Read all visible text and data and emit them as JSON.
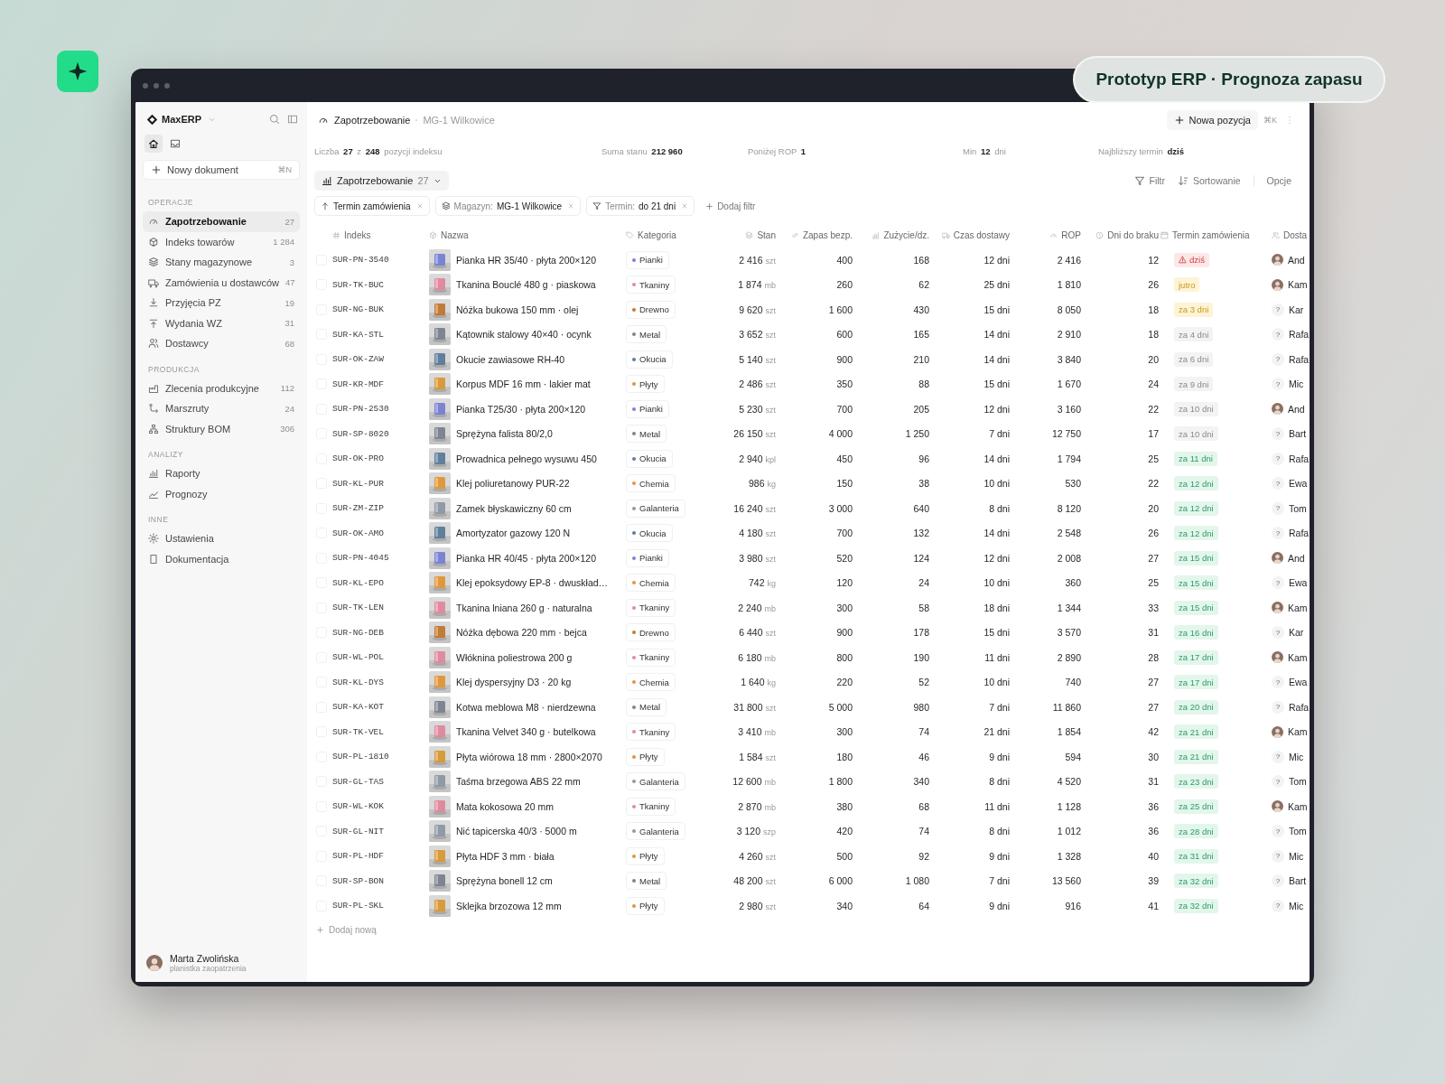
{
  "overlay_label": "Prototyp ERP · Prognoza zapasu",
  "sidebar": {
    "brand": "MaxERP",
    "top_icons": [
      {
        "kind": "home",
        "selected": true
      },
      {
        "kind": "inbox",
        "selected": false
      }
    ],
    "new_document": {
      "label": "Nowy dokument",
      "shortcut": "⌘N"
    },
    "sections": [
      {
        "title": "OPERACJE",
        "items": [
          {
            "label": "Zapotrzebowanie",
            "count": "27",
            "kind": "gauge",
            "selected": true
          },
          {
            "label": "Indeks towarów",
            "count": "1 284",
            "kind": "cube",
            "selected": false
          },
          {
            "label": "Stany magazynowe",
            "count": "3",
            "kind": "layers",
            "selected": false
          },
          {
            "label": "Zamówienia u dostawców",
            "count": "47",
            "kind": "truck",
            "selected": false
          },
          {
            "label": "Przyjęcia PZ",
            "count": "19",
            "kind": "download",
            "selected": false
          },
          {
            "label": "Wydania WZ",
            "count": "31",
            "kind": "upload",
            "selected": false
          },
          {
            "label": "Dostawcy",
            "count": "68",
            "kind": "people",
            "selected": false
          }
        ]
      },
      {
        "title": "PRODUKCJA",
        "items": [
          {
            "label": "Zlecenia produkcyjne",
            "count": "112",
            "kind": "factory",
            "selected": false
          },
          {
            "label": "Marszruty",
            "count": "24",
            "kind": "route",
            "selected": false
          },
          {
            "label": "Struktury BOM",
            "count": "306",
            "kind": "hierarchy",
            "selected": false
          }
        ]
      },
      {
        "title": "ANALIZY",
        "items": [
          {
            "label": "Raporty",
            "kind": "chart",
            "selected": false
          },
          {
            "label": "Prognozy",
            "kind": "trend",
            "selected": false
          }
        ]
      },
      {
        "title": "INNE",
        "items": [
          {
            "label": "Ustawienia",
            "kind": "settings",
            "selected": false
          },
          {
            "label": "Dokumentacja",
            "kind": "document",
            "selected": false
          }
        ]
      }
    ],
    "user": {
      "name": "Marta Zwolińska",
      "role": "planistka zaopatrzenia"
    }
  },
  "header": {
    "breadcrumb": [
      "Zapotrzebowanie",
      "MG-1 Wilkowice"
    ],
    "new_button": "Nowa pozycja",
    "shortcut": "⌘K"
  },
  "stats": [
    "Liczba **27** z **248** pozycji indeksu",
    "Suma stanu **212 960**",
    "Poniżej ROP **1**",
    "Min **12** dni",
    "Najbliższy termin **dziś**"
  ],
  "view": {
    "label": "Zapotrzebowanie",
    "count": "27"
  },
  "toolbar": [
    {
      "label": "Filtr",
      "kind": "filter"
    },
    {
      "label": "Sortowanie",
      "kind": "sort"
    },
    {
      "label": "Opcje",
      "kind": "plain"
    }
  ],
  "filters": [
    {
      "kind": "sort",
      "label": "Termin zamówienia"
    },
    {
      "kind": "warehouse",
      "label": "Magazyn:",
      "value": "MG-1 Wilkowice"
    },
    {
      "kind": "filter",
      "label": "Termin:",
      "value": "do 21 dni"
    }
  ],
  "add_filter": "Dodaj filtr",
  "table": {
    "columns": [
      {
        "label": "Indeks",
        "kind": "hash"
      },
      {
        "label": "Nazwa",
        "kind": "cube"
      },
      {
        "label": "Kategoria",
        "kind": "tag"
      },
      {
        "label": "Stan",
        "kind": "layers"
      },
      {
        "label": "Zapas bezp.",
        "kind": "link"
      },
      {
        "label": "Zużycie/dz.",
        "kind": "chart"
      },
      {
        "label": "Czas dostawy",
        "kind": "truck"
      },
      {
        "label": "ROP",
        "kind": "gauge"
      },
      {
        "label": "Dni do braku",
        "kind": "clock"
      },
      {
        "label": "Termin zamówienia",
        "kind": "calendar"
      },
      {
        "label": "Dosta",
        "kind": "people"
      }
    ],
    "rows": [
      {
        "selected": false,
        "index": "SUR-PN-3540",
        "name": "Pianka HR 35/40 · płyta 200×120",
        "category": {
          "label": "Pianki",
          "color": "#7b83d4"
        },
        "stock": "2 416",
        "unit": "szt",
        "safety": "400",
        "usage": "168",
        "lead": "12 dni",
        "rop": "2 416",
        "days": "12",
        "due": {
          "label": "dziś",
          "kind": "danger"
        },
        "supplier": {
          "name": "And"
        }
      },
      {
        "selected": false,
        "index": "SUR-TK-BUC",
        "name": "Tkanina Bouclé 480 g · piaskowa",
        "category": {
          "label": "Tkaniny",
          "color": "#e08aa0"
        },
        "stock": "1 874",
        "unit": "mb",
        "safety": "260",
        "usage": "62",
        "lead": "25 dni",
        "rop": "1 810",
        "days": "26",
        "due": {
          "label": "jutro",
          "kind": "warning"
        },
        "supplier": {
          "name": "Kam"
        }
      },
      {
        "selected": false,
        "index": "SUR-NG-BUK",
        "name": "Nóżka bukowa 150 mm · olej",
        "category": {
          "label": "Drewno",
          "color": "#c27a35"
        },
        "stock": "9 620",
        "unit": "szt",
        "safety": "1 600",
        "usage": "430",
        "lead": "15 dni",
        "rop": "8 050",
        "days": "18",
        "due": {
          "label": "za 3 dni",
          "kind": "warning"
        },
        "supplier": {
          "name": "Kar",
          "kind": "unknown",
          "mark": "?"
        }
      },
      {
        "selected": false,
        "index": "SUR-KA-STL",
        "name": "Kątownik stalowy 40×40 · ocynk",
        "category": {
          "label": "Metal",
          "color": "#7d8591"
        },
        "stock": "3 652",
        "unit": "szt",
        "safety": "600",
        "usage": "165",
        "lead": "14 dni",
        "rop": "2 910",
        "days": "18",
        "due": {
          "label": "za 4 dni",
          "kind": "neutral"
        },
        "supplier": {
          "name": "Rafa",
          "kind": "unknown",
          "mark": "?"
        }
      },
      {
        "selected": false,
        "index": "SUR-OK-ZAW",
        "name": "Okucie zawiasowe RH-40",
        "category": {
          "label": "Okucia",
          "color": "#5f7f9c"
        },
        "stock": "5 140",
        "unit": "szt",
        "safety": "900",
        "usage": "210",
        "lead": "14 dni",
        "rop": "3 840",
        "days": "20",
        "due": {
          "label": "za 6 dni",
          "kind": "neutral"
        },
        "supplier": {
          "name": "Rafa",
          "kind": "unknown",
          "mark": "?"
        }
      },
      {
        "selected": false,
        "index": "SUR-KR-MDF",
        "name": "Korpus MDF 16 mm · lakier mat",
        "category": {
          "label": "Płyty",
          "color": "#d89a3a"
        },
        "stock": "2 486",
        "unit": "szt",
        "safety": "350",
        "usage": "88",
        "lead": "15 dni",
        "rop": "1 670",
        "days": "24",
        "due": {
          "label": "za 9 dni",
          "kind": "neutral"
        },
        "supplier": {
          "name": "Mic",
          "kind": "unknown",
          "mark": "?"
        }
      },
      {
        "selected": false,
        "index": "SUR-PN-2530",
        "name": "Pianka T25/30 · płyta 200×120",
        "category": {
          "label": "Pianki",
          "color": "#7b83d4"
        },
        "stock": "5 230",
        "unit": "szt",
        "safety": "700",
        "usage": "205",
        "lead": "12 dni",
        "rop": "3 160",
        "days": "22",
        "due": {
          "label": "za 10 dni",
          "kind": "neutral"
        },
        "supplier": {
          "name": "And"
        }
      },
      {
        "selected": false,
        "index": "SUR-SP-8020",
        "name": "Sprężyna falista 80/2,0",
        "category": {
          "label": "Metal",
          "color": "#7d8591"
        },
        "stock": "26 150",
        "unit": "szt",
        "safety": "4 000",
        "usage": "1 250",
        "lead": "7 dni",
        "rop": "12 750",
        "days": "17",
        "due": {
          "label": "za 10 dni",
          "kind": "neutral"
        },
        "supplier": {
          "name": "Bart",
          "kind": "unknown",
          "mark": "?"
        }
      },
      {
        "selected": false,
        "index": "SUR-OK-PRO",
        "name": "Prowadnica pełnego wysuwu 450",
        "category": {
          "label": "Okucia",
          "color": "#5f7f9c"
        },
        "stock": "2 940",
        "unit": "kpl",
        "safety": "450",
        "usage": "96",
        "lead": "14 dni",
        "rop": "1 794",
        "days": "25",
        "due": {
          "label": "za 11 dni",
          "kind": "ok"
        },
        "supplier": {
          "name": "Rafa",
          "kind": "unknown",
          "mark": "?"
        }
      },
      {
        "selected": false,
        "index": "SUR-KL-PUR",
        "name": "Klej poliuretanowy PUR-22",
        "category": {
          "label": "Chemia",
          "color": "#e0983c"
        },
        "stock": "986",
        "unit": "kg",
        "safety": "150",
        "usage": "38",
        "lead": "10 dni",
        "rop": "530",
        "days": "22",
        "due": {
          "label": "za 12 dni",
          "kind": "ok"
        },
        "supplier": {
          "name": "Ewa",
          "kind": "unknown",
          "mark": "?"
        }
      },
      {
        "selected": false,
        "index": "SUR-ZM-ZIP",
        "name": "Zamek błyskawiczny 60 cm",
        "category": {
          "label": "Galanteria",
          "color": "#8f9aa6"
        },
        "stock": "16 240",
        "unit": "szt",
        "safety": "3 000",
        "usage": "640",
        "lead": "8 dni",
        "rop": "8 120",
        "days": "20",
        "due": {
          "label": "za 12 dni",
          "kind": "ok"
        },
        "supplier": {
          "name": "Tom",
          "kind": "unknown",
          "mark": "?"
        }
      },
      {
        "selected": false,
        "index": "SUR-OK-AMO",
        "name": "Amortyzator gazowy 120 N",
        "category": {
          "label": "Okucia",
          "color": "#5f7f9c"
        },
        "stock": "4 180",
        "unit": "szt",
        "safety": "700",
        "usage": "132",
        "lead": "14 dni",
        "rop": "2 548",
        "days": "26",
        "due": {
          "label": "za 12 dni",
          "kind": "ok"
        },
        "supplier": {
          "name": "Rafa",
          "kind": "unknown",
          "mark": "?"
        }
      },
      {
        "selected": false,
        "index": "SUR-PN-4045",
        "name": "Pianka HR 40/45 · płyta 200×120",
        "category": {
          "label": "Pianki",
          "color": "#7b83d4"
        },
        "stock": "3 980",
        "unit": "szt",
        "safety": "520",
        "usage": "124",
        "lead": "12 dni",
        "rop": "2 008",
        "days": "27",
        "due": {
          "label": "za 15 dni",
          "kind": "ok"
        },
        "supplier": {
          "name": "And"
        }
      },
      {
        "selected": false,
        "index": "SUR-KL-EPO",
        "name": "Klej epoksydowy EP-8 · dwuskład…",
        "category": {
          "label": "Chemia",
          "color": "#e0983c"
        },
        "stock": "742",
        "unit": "kg",
        "safety": "120",
        "usage": "24",
        "lead": "10 dni",
        "rop": "360",
        "days": "25",
        "due": {
          "label": "za 15 dni",
          "kind": "ok"
        },
        "supplier": {
          "name": "Ewa",
          "kind": "unknown",
          "mark": "?"
        }
      },
      {
        "selected": false,
        "index": "SUR-TK-LEN",
        "name": "Tkanina lniana 260 g · naturalna",
        "category": {
          "label": "Tkaniny",
          "color": "#e08aa0"
        },
        "stock": "2 240",
        "unit": "mb",
        "safety": "300",
        "usage": "58",
        "lead": "18 dni",
        "rop": "1 344",
        "days": "33",
        "due": {
          "label": "za 15 dni",
          "kind": "ok"
        },
        "supplier": {
          "name": "Kam"
        }
      },
      {
        "selected": false,
        "index": "SUR-NG-DEB",
        "name": "Nóżka dębowa 220 mm · bejca",
        "category": {
          "label": "Drewno",
          "color": "#c27a35"
        },
        "stock": "6 440",
        "unit": "szt",
        "safety": "900",
        "usage": "178",
        "lead": "15 dni",
        "rop": "3 570",
        "days": "31",
        "due": {
          "label": "za 16 dni",
          "kind": "ok"
        },
        "supplier": {
          "name": "Kar",
          "kind": "unknown",
          "mark": "?"
        }
      },
      {
        "selected": false,
        "index": "SUR-WL-POL",
        "name": "Włóknina poliestrowa 200 g",
        "category": {
          "label": "Tkaniny",
          "color": "#e08aa0"
        },
        "stock": "6 180",
        "unit": "mb",
        "safety": "800",
        "usage": "190",
        "lead": "11 dni",
        "rop": "2 890",
        "days": "28",
        "due": {
          "label": "za 17 dni",
          "kind": "ok"
        },
        "supplier": {
          "name": "Kam"
        }
      },
      {
        "selected": false,
        "index": "SUR-KL-DYS",
        "name": "Klej dyspersyjny D3 · 20 kg",
        "category": {
          "label": "Chemia",
          "color": "#e0983c"
        },
        "stock": "1 640",
        "unit": "kg",
        "safety": "220",
        "usage": "52",
        "lead": "10 dni",
        "rop": "740",
        "days": "27",
        "due": {
          "label": "za 17 dni",
          "kind": "ok"
        },
        "supplier": {
          "name": "Ewa",
          "kind": "unknown",
          "mark": "?"
        }
      },
      {
        "selected": false,
        "index": "SUR-KA-KOT",
        "name": "Kotwa meblowa M8 · nierdzewna",
        "category": {
          "label": "Metal",
          "color": "#7d8591"
        },
        "stock": "31 800",
        "unit": "szt",
        "safety": "5 000",
        "usage": "980",
        "lead": "7 dni",
        "rop": "11 860",
        "days": "27",
        "due": {
          "label": "za 20 dni",
          "kind": "ok"
        },
        "supplier": {
          "name": "Rafa",
          "kind": "unknown",
          "mark": "?"
        }
      },
      {
        "selected": false,
        "index": "SUR-TK-VEL",
        "name": "Tkanina Velvet 340 g · butelkowa",
        "category": {
          "label": "Tkaniny",
          "color": "#e08aa0"
        },
        "stock": "3 410",
        "unit": "mb",
        "safety": "300",
        "usage": "74",
        "lead": "21 dni",
        "rop": "1 854",
        "days": "42",
        "due": {
          "label": "za 21 dni",
          "kind": "ok"
        },
        "supplier": {
          "name": "Kam"
        }
      },
      {
        "selected": false,
        "index": "SUR-PL-1810",
        "name": "Płyta wiórowa 18 mm · 2800×2070",
        "category": {
          "label": "Płyty",
          "color": "#d89a3a"
        },
        "stock": "1 584",
        "unit": "szt",
        "safety": "180",
        "usage": "46",
        "lead": "9 dni",
        "rop": "594",
        "days": "30",
        "due": {
          "label": "za 21 dni",
          "kind": "ok"
        },
        "supplier": {
          "name": "Mic",
          "kind": "unknown",
          "mark": "?"
        }
      },
      {
        "selected": false,
        "index": "SUR-GL-TAS",
        "name": "Taśma brzegowa ABS 22 mm",
        "category": {
          "label": "Galanteria",
          "color": "#8f9aa6"
        },
        "stock": "12 600",
        "unit": "mb",
        "safety": "1 800",
        "usage": "340",
        "lead": "8 dni",
        "rop": "4 520",
        "days": "31",
        "due": {
          "label": "za 23 dni",
          "kind": "ok"
        },
        "supplier": {
          "name": "Tom",
          "kind": "unknown",
          "mark": "?"
        }
      },
      {
        "selected": false,
        "index": "SUR-WL-KOK",
        "name": "Mata kokosowa 20 mm",
        "category": {
          "label": "Tkaniny",
          "color": "#e08aa0"
        },
        "stock": "2 870",
        "unit": "mb",
        "safety": "380",
        "usage": "68",
        "lead": "11 dni",
        "rop": "1 128",
        "days": "36",
        "due": {
          "label": "za 25 dni",
          "kind": "ok"
        },
        "supplier": {
          "name": "Kam"
        }
      },
      {
        "selected": false,
        "index": "SUR-GL-NIT",
        "name": "Nić tapicerska 40/3 · 5000 m",
        "category": {
          "label": "Galanteria",
          "color": "#8f9aa6"
        },
        "stock": "3 120",
        "unit": "szp",
        "safety": "420",
        "usage": "74",
        "lead": "8 dni",
        "rop": "1 012",
        "days": "36",
        "due": {
          "label": "za 28 dni",
          "kind": "ok"
        },
        "supplier": {
          "name": "Tom",
          "kind": "unknown",
          "mark": "?"
        }
      },
      {
        "selected": false,
        "index": "SUR-PL-HDF",
        "name": "Płyta HDF 3 mm · biała",
        "category": {
          "label": "Płyty",
          "color": "#d89a3a"
        },
        "stock": "4 260",
        "unit": "szt",
        "safety": "500",
        "usage": "92",
        "lead": "9 dni",
        "rop": "1 328",
        "days": "40",
        "due": {
          "label": "za 31 dni",
          "kind": "ok"
        },
        "supplier": {
          "name": "Mic",
          "kind": "unknown",
          "mark": "?"
        }
      },
      {
        "selected": false,
        "index": "SUR-SP-BON",
        "name": "Sprężyna bonell 12 cm",
        "category": {
          "label": "Metal",
          "color": "#7d8591"
        },
        "stock": "48 200",
        "unit": "szt",
        "safety": "6 000",
        "usage": "1 080",
        "lead": "7 dni",
        "rop": "13 560",
        "days": "39",
        "due": {
          "label": "za 32 dni",
          "kind": "ok"
        },
        "supplier": {
          "name": "Bart",
          "kind": "unknown",
          "mark": "?"
        }
      },
      {
        "selected": false,
        "index": "SUR-PL-SKL",
        "name": "Sklejka brzozowa 12 mm",
        "category": {
          "label": "Płyty",
          "color": "#d89a3a"
        },
        "stock": "2 980",
        "unit": "szt",
        "safety": "340",
        "usage": "64",
        "lead": "9 dni",
        "rop": "916",
        "days": "41",
        "due": {
          "label": "za 32 dni",
          "kind": "ok"
        },
        "supplier": {
          "name": "Mic",
          "kind": "unknown",
          "mark": "?"
        }
      }
    ],
    "add_row": "Dodaj nową"
  }
}
